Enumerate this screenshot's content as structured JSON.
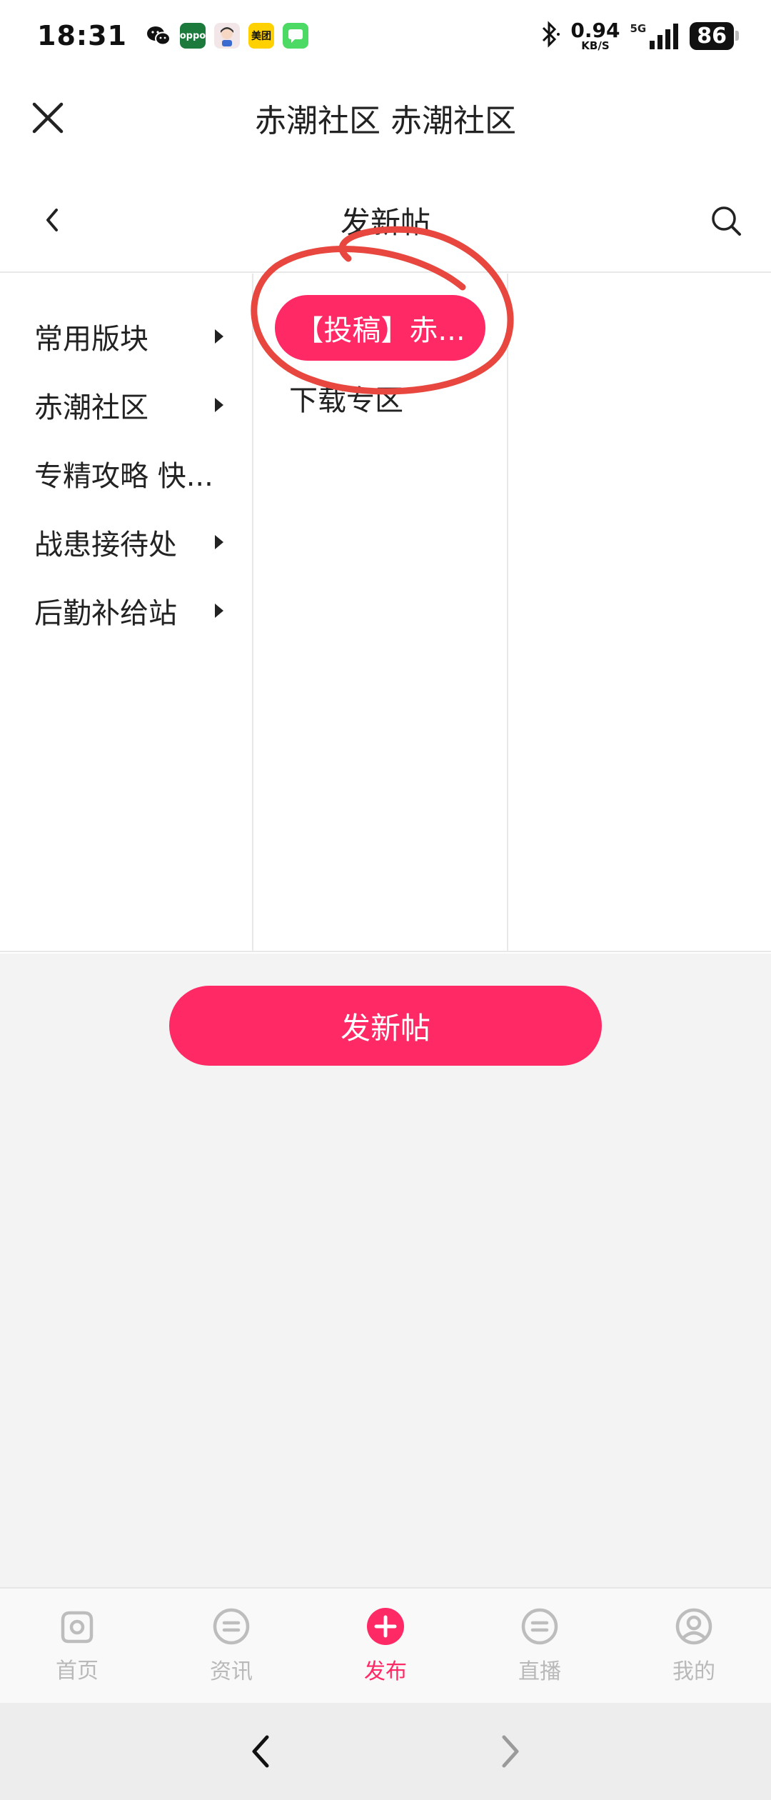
{
  "status_bar": {
    "time": "18:31",
    "net_speed_value": "0.94",
    "net_speed_unit": "KB/S",
    "signal": "5G",
    "battery": "86",
    "apps": [
      {
        "name": "wechat-icon",
        "text": ""
      },
      {
        "name": "oppo-store-icon",
        "text": "oppo"
      },
      {
        "name": "avatar-app-icon",
        "text": ""
      },
      {
        "name": "meituan-icon",
        "text": "美团"
      },
      {
        "name": "messages-icon",
        "text": ""
      }
    ]
  },
  "app_header": {
    "title": "赤潮社区 赤潮社区"
  },
  "page_header": {
    "title": "发新帖"
  },
  "categories": [
    {
      "label": "常用版块",
      "has_arrow": true
    },
    {
      "label": "赤潮社区",
      "has_arrow": true
    },
    {
      "label": "专精攻略 快...",
      "has_arrow": false
    },
    {
      "label": "战患接待处",
      "has_arrow": true
    },
    {
      "label": "后勤补给站",
      "has_arrow": true
    }
  ],
  "subcategories": [
    {
      "label": "【投稿】赤...",
      "selected": true
    },
    {
      "label": "下载专区",
      "selected": false
    }
  ],
  "actions": {
    "post_label": "发新帖"
  },
  "bottom_nav": [
    {
      "label": "首页",
      "icon": "home-icon",
      "active": false
    },
    {
      "label": "资讯",
      "icon": "news-icon",
      "active": false
    },
    {
      "label": "发布",
      "icon": "publish-icon",
      "active": true
    },
    {
      "label": "直播",
      "icon": "live-icon",
      "active": false
    },
    {
      "label": "我的",
      "icon": "profile-icon",
      "active": false
    }
  ],
  "colors": {
    "accent": "#ff2a65",
    "annotation": "#e8473f",
    "inactive": "#b9b9b9"
  }
}
